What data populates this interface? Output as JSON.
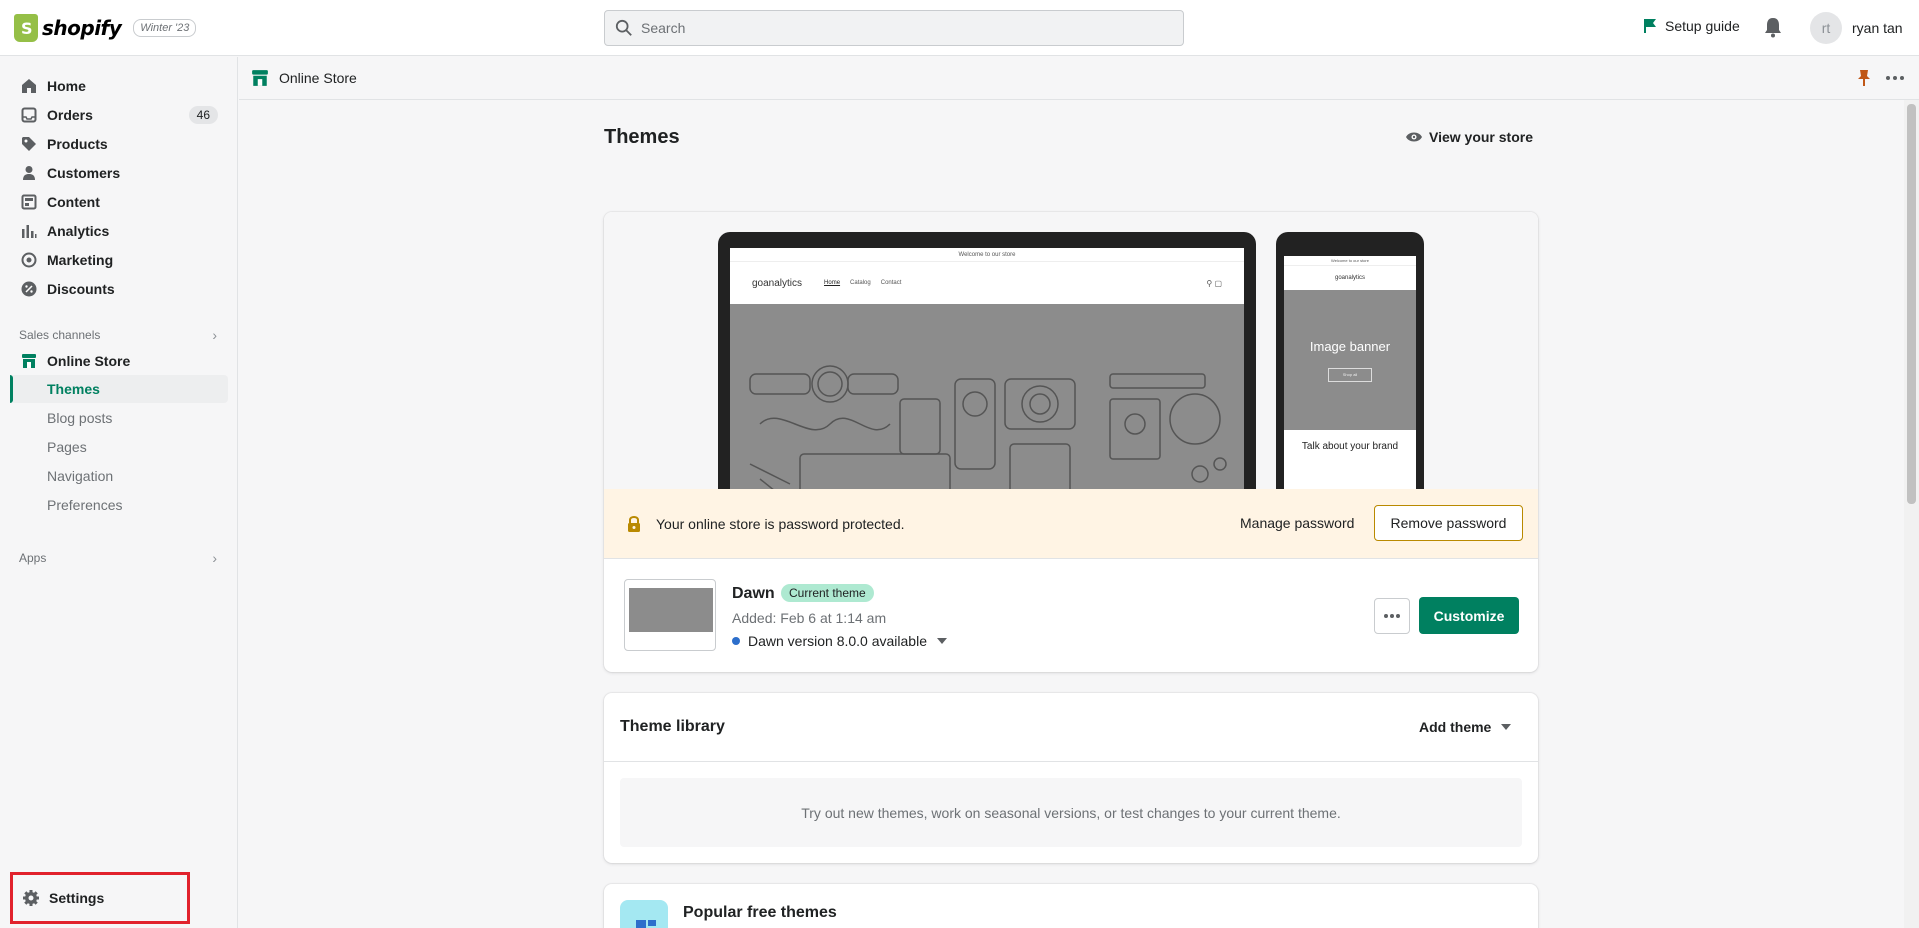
{
  "brand": {
    "name": "shopify",
    "edition": "Winter '23"
  },
  "search": {
    "placeholder": "Search"
  },
  "topbar": {
    "setup_guide": "Setup guide",
    "user_initials": "rt",
    "user_name": "ryan tan"
  },
  "sidebar": {
    "items": [
      {
        "label": "Home",
        "icon": "home-icon"
      },
      {
        "label": "Orders",
        "icon": "orders-icon",
        "badge": "46"
      },
      {
        "label": "Products",
        "icon": "tag-icon"
      },
      {
        "label": "Customers",
        "icon": "person-icon"
      },
      {
        "label": "Content",
        "icon": "content-icon"
      },
      {
        "label": "Analytics",
        "icon": "bar-chart-icon"
      },
      {
        "label": "Marketing",
        "icon": "target-icon"
      },
      {
        "label": "Discounts",
        "icon": "discount-icon"
      }
    ],
    "sales_channels_heading": "Sales channels",
    "online_store": "Online Store",
    "sub_items": [
      "Themes",
      "Blog posts",
      "Pages",
      "Navigation",
      "Preferences"
    ],
    "apps_heading": "Apps",
    "settings": "Settings"
  },
  "breadcrumb": {
    "title": "Online Store"
  },
  "page": {
    "title": "Themes",
    "view_store": "View your store"
  },
  "preview": {
    "announcement": "Welcome to our store",
    "store_name": "goanalytics",
    "nav": [
      "Home",
      "Catalog",
      "Contact"
    ],
    "mobile_banner": "Image banner",
    "mobile_button": "Shop all",
    "mobile_heading": "Talk about your brand"
  },
  "password_banner": {
    "text": "Your online store is password protected.",
    "manage": "Manage password",
    "remove": "Remove password"
  },
  "current_theme": {
    "name": "Dawn",
    "badge": "Current theme",
    "added": "Added: Feb 6 at 1:14 am",
    "version": "Dawn version 8.0.0 available",
    "customize": "Customize"
  },
  "library": {
    "title": "Theme library",
    "add_theme": "Add theme",
    "empty_text": "Try out new themes, work on seasonal versions, or test changes to your current theme."
  },
  "popular": {
    "title": "Popular free themes"
  },
  "colors": {
    "accent": "#008060",
    "highlight": "#e1222c",
    "banner": "#fff4e4"
  }
}
